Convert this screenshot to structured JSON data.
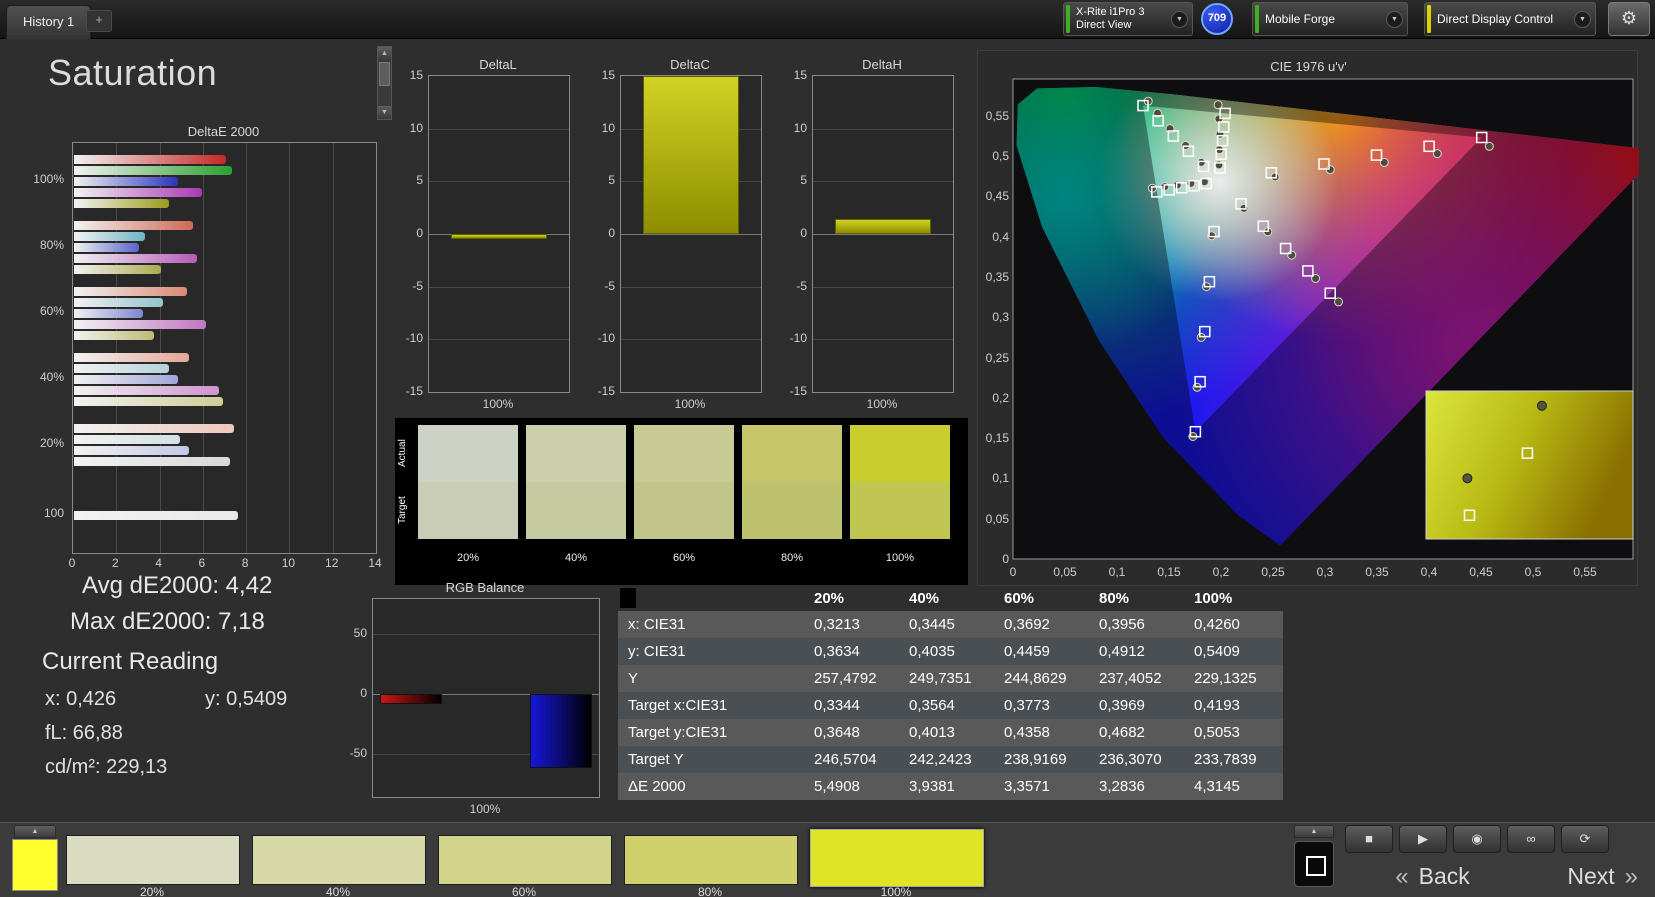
{
  "colors": {
    "stripe_green": "#3fae24",
    "stripe_yellow": "#d8d400",
    "badge_blue": "#1636c8",
    "patch_yellow": "#ffff2e",
    "accent_olive": "#b0b000"
  },
  "icons": {
    "dropdown": "▼",
    "gear": "⚙",
    "scroll_up": "▲",
    "scroll_down": "▼",
    "up_chevron": "▲",
    "stop": "■",
    "play": "▶",
    "record": "◉",
    "loop": "∞",
    "refresh": "⟳",
    "back_chevron": "«",
    "next_chevron": "»"
  },
  "top_bar": {
    "tab_label": "History 1",
    "add_label": "+",
    "meter_line1": "X-Rite i1Pro 3",
    "meter_line2": "Direct View",
    "badge": "709",
    "source": "Mobile Forge",
    "control": "Direct Display Control"
  },
  "page": {
    "title": "Saturation"
  },
  "deltae_chart": {
    "title": "DeltaE 2000",
    "x_ticks": [
      "0",
      "2",
      "4",
      "6",
      "8",
      "10",
      "12",
      "14"
    ],
    "x_max": 14,
    "groups": [
      {
        "label": "100%",
        "bars": [
          {
            "color": "#c62828",
            "v": 7.0
          },
          {
            "color": "#2e9e30",
            "v": 7.3
          },
          {
            "color": "#2c34bc",
            "v": 4.8
          },
          {
            "color": "#a93ab5",
            "v": 5.9
          },
          {
            "color": "#9c9c20",
            "v": 4.4
          }
        ]
      },
      {
        "label": "80%",
        "bars": [
          {
            "color": "#cf6a56",
            "v": 5.5
          },
          {
            "color": "#6fb4c4",
            "v": 3.3
          },
          {
            "color": "#5a64c8",
            "v": 3.0
          },
          {
            "color": "#b55cb5",
            "v": 5.7
          },
          {
            "color": "#abab4e",
            "v": 4.0
          }
        ]
      },
      {
        "label": "60%",
        "bars": [
          {
            "color": "#d98a76",
            "v": 5.2
          },
          {
            "color": "#93c3cd",
            "v": 4.1
          },
          {
            "color": "#7e86d0",
            "v": 3.2
          },
          {
            "color": "#c077c0",
            "v": 6.1
          },
          {
            "color": "#bcbc74",
            "v": 3.7
          }
        ]
      },
      {
        "label": "40%",
        "bars": [
          {
            "color": "#e3a795",
            "v": 5.3
          },
          {
            "color": "#b4d2d8",
            "v": 4.4
          },
          {
            "color": "#a0a6da",
            "v": 4.8
          },
          {
            "color": "#cf94cd",
            "v": 6.7
          },
          {
            "color": "#cdcd96",
            "v": 6.9
          }
        ]
      },
      {
        "label": "20%",
        "bars": [
          {
            "color": "#edc8bb",
            "v": 7.4
          },
          {
            "color": "#d2e1e4",
            "v": 4.9
          },
          {
            "color": "#c3c8e6",
            "v": 5.3
          },
          {
            "color": "#d8d8d8",
            "v": 7.2
          }
        ]
      },
      {
        "label": "100",
        "bars": [
          {
            "color": "#e9e9e9",
            "v": 7.6
          }
        ]
      }
    ]
  },
  "delta_axis": {
    "ticks": [
      "15",
      "10",
      "5",
      "0",
      "-5",
      "-10",
      "-15"
    ],
    "min": -15,
    "max": 15
  },
  "delta_charts": [
    {
      "title": "DeltaL",
      "bar_value": -0.5,
      "x_label": "100%"
    },
    {
      "title": "DeltaC",
      "bar_value": 15,
      "x_label": "100%"
    },
    {
      "title": "DeltaH",
      "bar_value": 1.4,
      "x_label": "100%"
    }
  ],
  "swatch_panel": {
    "row_labels": [
      "Actual",
      "Target"
    ],
    "swatches": [
      {
        "label": "20%",
        "actual": "#cdd2c6",
        "target": "#c9cdb6"
      },
      {
        "label": "40%",
        "actual": "#cbcfac",
        "target": "#c6caa0"
      },
      {
        "label": "60%",
        "actual": "#c7ca93",
        "target": "#c1c589"
      },
      {
        "label": "80%",
        "actual": "#c5c76a",
        "target": "#bec26e"
      },
      {
        "label": "100%",
        "actual": "#c9cd30",
        "target": "#c1c652"
      }
    ]
  },
  "cie": {
    "title": "CIE 1976 u'v'",
    "x_ticks": [
      "0",
      "0,05",
      "0,1",
      "0,15",
      "0,2",
      "0,25",
      "0,3",
      "0,35",
      "0,4",
      "0,45",
      "0,5",
      "0,55"
    ],
    "y_ticks": [
      "0",
      "0,05",
      "0,1",
      "0,15",
      "0,2",
      "0,25",
      "0,3",
      "0,35",
      "0,4",
      "0,45",
      "0,5",
      "0,55"
    ],
    "targets": [
      [
        0.2484,
        0.4792
      ],
      [
        0.299,
        0.4901
      ],
      [
        0.3495,
        0.5011
      ],
      [
        0.4001,
        0.512
      ],
      [
        0.4507,
        0.5229
      ],
      [
        0.1832,
        0.4871
      ],
      [
        0.1687,
        0.506
      ],
      [
        0.1541,
        0.5248
      ],
      [
        0.1396,
        0.5437
      ],
      [
        0.125,
        0.5625
      ],
      [
        0.1933,
        0.4062
      ],
      [
        0.1888,
        0.3441
      ],
      [
        0.1844,
        0.2821
      ],
      [
        0.1799,
        0.22
      ],
      [
        0.1754,
        0.1579
      ],
      [
        0.1859,
        0.4657
      ],
      [
        0.174,
        0.4631
      ],
      [
        0.1621,
        0.4606
      ],
      [
        0.1502,
        0.458
      ],
      [
        0.1383,
        0.4554
      ],
      [
        0.2192,
        0.4406
      ],
      [
        0.2407,
        0.4129
      ],
      [
        0.2621,
        0.3852
      ],
      [
        0.2836,
        0.3575
      ],
      [
        0.305,
        0.3298
      ],
      [
        0.199,
        0.4852
      ],
      [
        0.2002,
        0.5021
      ],
      [
        0.2015,
        0.519
      ],
      [
        0.2027,
        0.536
      ],
      [
        0.2039,
        0.5529
      ]
    ],
    "measurements": [
      [
        0.252,
        0.474
      ],
      [
        0.305,
        0.483
      ],
      [
        0.357,
        0.492
      ],
      [
        0.408,
        0.503
      ],
      [
        0.458,
        0.512
      ],
      [
        0.181,
        0.492
      ],
      [
        0.166,
        0.513
      ],
      [
        0.151,
        0.534
      ],
      [
        0.139,
        0.553
      ],
      [
        0.13,
        0.568
      ],
      [
        0.191,
        0.401
      ],
      [
        0.186,
        0.338
      ],
      [
        0.181,
        0.275
      ],
      [
        0.177,
        0.213
      ],
      [
        0.173,
        0.152
      ],
      [
        0.184,
        0.468
      ],
      [
        0.171,
        0.466
      ],
      [
        0.158,
        0.464
      ],
      [
        0.146,
        0.462
      ],
      [
        0.134,
        0.46
      ],
      [
        0.222,
        0.435
      ],
      [
        0.245,
        0.406
      ],
      [
        0.268,
        0.377
      ],
      [
        0.291,
        0.348
      ],
      [
        0.313,
        0.319
      ],
      [
        0.198,
        0.489
      ],
      [
        0.1985,
        0.508
      ],
      [
        0.199,
        0.527
      ],
      [
        0.198,
        0.546
      ],
      [
        0.1972,
        0.5635
      ]
    ],
    "inset": {
      "targets": [
        [
          0.49,
          0.42
        ],
        [
          0.21,
          0.84
        ]
      ],
      "measurements": [
        [
          0.56,
          0.1
        ],
        [
          0.2,
          0.59
        ]
      ]
    }
  },
  "readings": {
    "avg": "Avg dE2000: 4,42",
    "max": "Max dE2000: 7,18",
    "current_heading": "Current Reading",
    "x": "x: 0,426",
    "y": "y: 0,5409",
    "fl": "fL: 66,88",
    "cdm2": "cd/m²: 229,13"
  },
  "rgb_balance": {
    "title": "RGB Balance",
    "y_ticks": [
      "50",
      "0",
      "-50"
    ],
    "bars": [
      {
        "color": "#cc1616",
        "v": -8
      },
      {
        "color": "#00a000",
        "v": 0
      },
      {
        "color": "#1616dd",
        "v": -62
      }
    ],
    "x_label": "100%"
  },
  "table": {
    "columns": [
      "20%",
      "40%",
      "60%",
      "80%",
      "100%"
    ],
    "rows": [
      {
        "label": "x: CIE31",
        "values": [
          "0,3213",
          "0,3445",
          "0,3692",
          "0,3956",
          "0,4260"
        ]
      },
      {
        "label": "y: CIE31",
        "values": [
          "0,3634",
          "0,4035",
          "0,4459",
          "0,4912",
          "0,5409"
        ]
      },
      {
        "label": "Y",
        "values": [
          "257,4792",
          "249,7351",
          "244,8629",
          "237,4052",
          "229,1325"
        ]
      },
      {
        "label": "Target x:CIE31",
        "values": [
          "0,3344",
          "0,3564",
          "0,3773",
          "0,3969",
          "0,4193"
        ]
      },
      {
        "label": "Target y:CIE31",
        "values": [
          "0,3648",
          "0,4013",
          "0,4358",
          "0,4682",
          "0,5053"
        ]
      },
      {
        "label": "Target Y",
        "values": [
          "246,5704",
          "242,2423",
          "238,9169",
          "236,3070",
          "233,7839"
        ]
      },
      {
        "label": "ΔE 2000",
        "values": [
          "5,4908",
          "3,9381",
          "3,3571",
          "3,2836",
          "4,3145"
        ]
      }
    ]
  },
  "bottom_bar": {
    "swatches": [
      {
        "label": "20%",
        "color": "#dadcc1",
        "active": false
      },
      {
        "label": "40%",
        "color": "#d6d8a6",
        "active": false
      },
      {
        "label": "60%",
        "color": "#d2d48b",
        "active": false
      },
      {
        "label": "80%",
        "color": "#d0d16d",
        "active": false
      },
      {
        "label": "100%",
        "color": "#e0e426",
        "active": true
      }
    ],
    "back_label": "Back",
    "next_label": "Next"
  }
}
